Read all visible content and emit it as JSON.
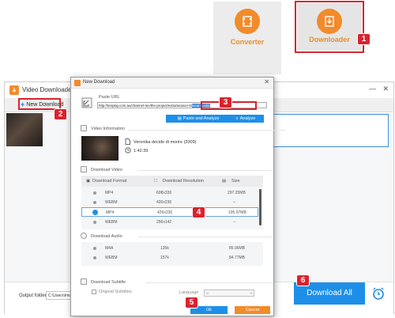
{
  "colors": {
    "accent_orange": "#f18b2c",
    "accent_blue": "#1e8fe8",
    "highlight_red": "#d9232d"
  },
  "tiles": [
    {
      "label": "Converter",
      "icon": "film-convert-icon"
    },
    {
      "label": "Downloader",
      "icon": "download-arrow-icon"
    }
  ],
  "badges": [
    "1",
    "2",
    "3",
    "4",
    "5",
    "6"
  ],
  "main_window": {
    "title": "Video Downloader",
    "new_download_label": "New Download",
    "output_folder_label": "Output folder:",
    "output_folder_value": "C:\\Users\\Imon\\",
    "download_all_label": "Download All"
  },
  "dialog": {
    "title": "New Download",
    "paste_url_label": "Paste URL",
    "url_value": "http://tenplay.com.au/channel-ten/the-project/extra/season-5/",
    "url_selected": "local-media",
    "paste_analyze_label": "Paste and Analyze",
    "analyze_label": "Analyze",
    "video_info_label": "Video Information",
    "video_title": "Veronika decide di morire (2009)",
    "video_duration": "1:42:39",
    "download_video_label": "Download Video",
    "columns": {
      "format": "Download Format",
      "resolution": "Download Resolution",
      "size": "Size"
    },
    "video_rows": [
      {
        "format": "MP4",
        "resolution": "608x336",
        "size": "297.25MB"
      },
      {
        "format": "WEBM",
        "resolution": "426x236",
        "size": "--"
      },
      {
        "format": "MP4",
        "resolution": "426x236",
        "size": "105.97MB"
      },
      {
        "format": "WEBM",
        "resolution": "256x142",
        "size": "--"
      }
    ],
    "selected_video_row": 2,
    "download_audio_label": "Download Audio",
    "audio_rows": [
      {
        "format": "M4A",
        "bitrate": "135k",
        "size": "85.06MB"
      },
      {
        "format": "WEBM",
        "bitrate": "157k",
        "size": "84.77MB"
      }
    ],
    "download_subtitle_label": "Download Subtitle",
    "original_subtitles_label": "Original Subtitles",
    "language_label": "Language",
    "language_value": "ie",
    "ok_label": "Ok",
    "cancel_label": "Cancel"
  }
}
